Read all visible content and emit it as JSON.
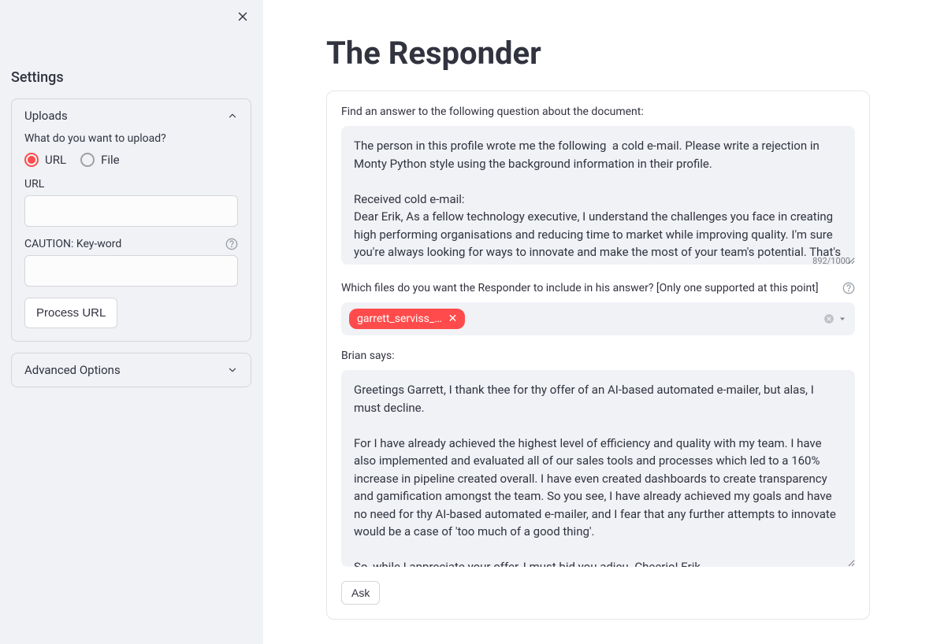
{
  "sidebar": {
    "title": "Settings",
    "uploads": {
      "header": "Uploads",
      "question": "What do you want to upload?",
      "option_url": "URL",
      "option_file": "File",
      "url_label": "URL",
      "url_value": "",
      "keyword_label": "CAUTION: Key-word",
      "keyword_value": "",
      "process_btn": "Process URL"
    },
    "advanced": {
      "header": "Advanced Options"
    }
  },
  "main": {
    "title": "The Responder",
    "question_label": "Find an answer to the following question about the document:",
    "question_value": "The person in this profile wrote me the following  a cold e-mail. Please write a rejection in Monty Python style using the background information in their profile.\n\nReceived cold e-mail:\nDear Erik, As a fellow technology executive, I understand the challenges you face in creating high performing organisations and reducing time to market while improving quality. I'm sure you're always looking for ways to innovate and make the most of your team's potential. That's why I'm",
    "counter": "892/1000",
    "files_label": "Which files do you want the Responder to include in his answer? [Only one supported at this point]",
    "chip": "garrett_serviss_…",
    "output_label": "Brian says:",
    "output_value": "Greetings Garrett, I thank thee for thy offer of an AI-based automated e-mailer, but alas, I must decline.\n\nFor I have already achieved the highest level of efficiency and quality with my team. I have also implemented and evaluated all of our sales tools and processes which led to a 160% increase in pipeline created overall. I have even created dashboards to create transparency and gamification amongst the team. So you see, I have already achieved my goals and have no need for thy AI-based automated e-mailer, and I fear that any further attempts to innovate would be a case of 'too much of a good thing'.\n\nSo, while I appreciate your offer, I must bid you adieu. Cheerio! Erik",
    "ask_btn": "Ask"
  }
}
